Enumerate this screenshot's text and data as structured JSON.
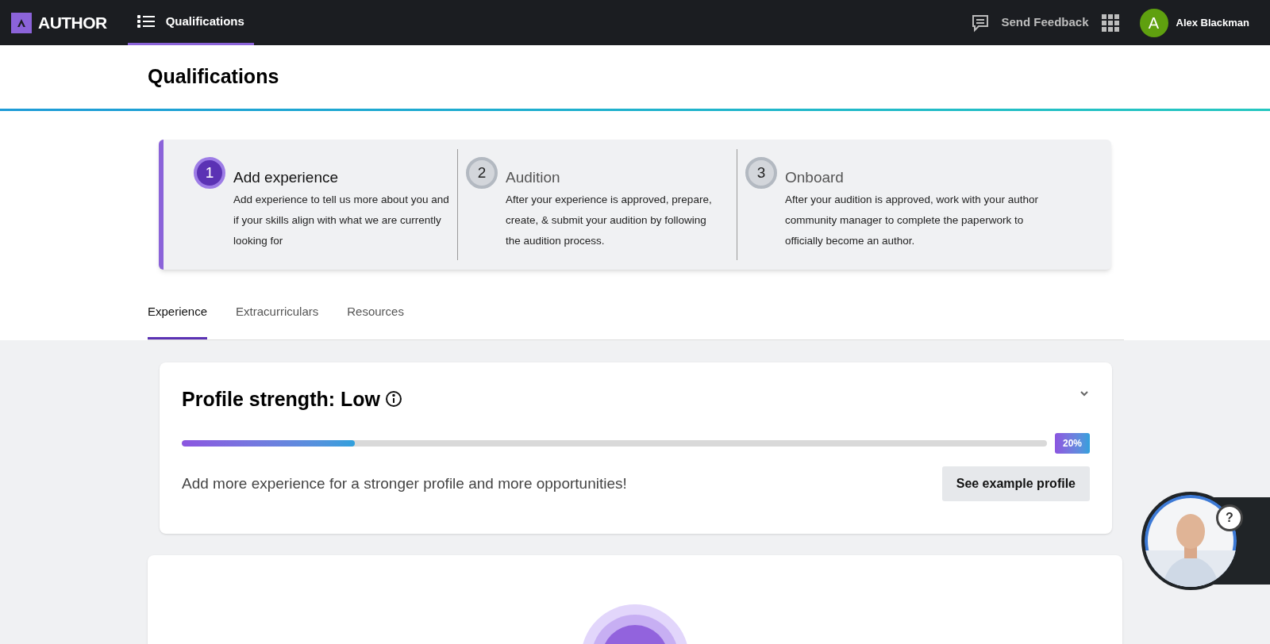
{
  "top_bar": {
    "logo": "AUTHOR",
    "nav": [
      {
        "label": "Qualifications",
        "selected": true
      }
    ],
    "feedback": "Send Feedback",
    "user": {
      "initial": "A",
      "name": "Alex Blackman"
    }
  },
  "page_title": "Qualifications",
  "steps": [
    {
      "number": "1",
      "title": "Add experience",
      "text": "Add experience to tell us more about you and if your skills align with what we are currently looking for",
      "selected": true
    },
    {
      "number": "2",
      "title": "Audition",
      "text": "After your experience is approved, prepare, create, & submit your audition by following the audition process.",
      "selected": false
    },
    {
      "number": "3",
      "title": "Onboard",
      "text": "After your audition is approved, work with your author community manager to complete the paperwork to officially become an author.",
      "selected": false
    }
  ],
  "tabs": [
    {
      "label": "Experience",
      "selected": true
    },
    {
      "label": "Extracurriculars",
      "selected": false
    },
    {
      "label": "Resources",
      "selected": false
    }
  ],
  "profile": {
    "title": "Profile strength: Low",
    "level": 0.2,
    "percent": "20%",
    "hint": "Add more experience for a stronger profile and more opportunities!",
    "button": "See example profile"
  },
  "help_bubble": {
    "badge": "?"
  }
}
